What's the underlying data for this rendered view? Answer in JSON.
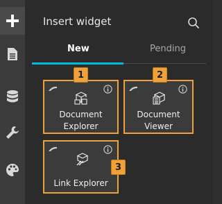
{
  "panel": {
    "title": "Insert widget",
    "tabs": [
      {
        "label": "New",
        "active": true
      },
      {
        "label": "Pending",
        "active": false
      }
    ]
  },
  "widgets": [
    {
      "label_line1": "Document",
      "label_line2": "Explorer",
      "badge": "1"
    },
    {
      "label_line1": "Document",
      "label_line2": "Viewer",
      "badge": "2"
    },
    {
      "label_line1": "Link Explorer",
      "label_line2": "",
      "badge": "3"
    }
  ],
  "rail_icons": [
    "plus-icon",
    "page-icon",
    "database-icon",
    "wrench-icon",
    "palette-icon"
  ],
  "colors": {
    "accent": "#00bcd4",
    "highlight": "#f0a23a"
  }
}
